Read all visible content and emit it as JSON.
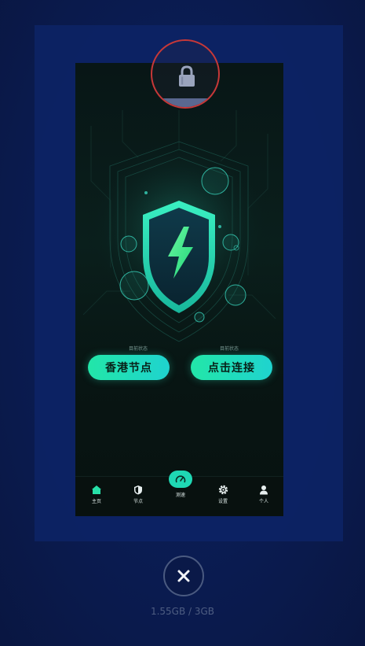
{
  "app": {
    "status_left_caption": "目前状态",
    "status_right_caption": "目前状态",
    "node_button_label": "香港节点",
    "connect_button_label": "点击连接",
    "tabs": [
      {
        "label": "主页",
        "icon": "home-icon"
      },
      {
        "label": "节点",
        "icon": "shield-icon"
      },
      {
        "label": "测速",
        "icon": "speedometer-icon"
      },
      {
        "label": "设置",
        "icon": "gear-icon"
      },
      {
        "label": "个人",
        "icon": "person-icon"
      }
    ]
  },
  "recents": {
    "memory_usage": "1.55GB / 3GB",
    "lock_icon": "lock-icon",
    "close_icon": "close-icon"
  },
  "colors": {
    "background": "#0b1d56",
    "accent": "#22e6a8",
    "lock_ring": "#c73838"
  }
}
